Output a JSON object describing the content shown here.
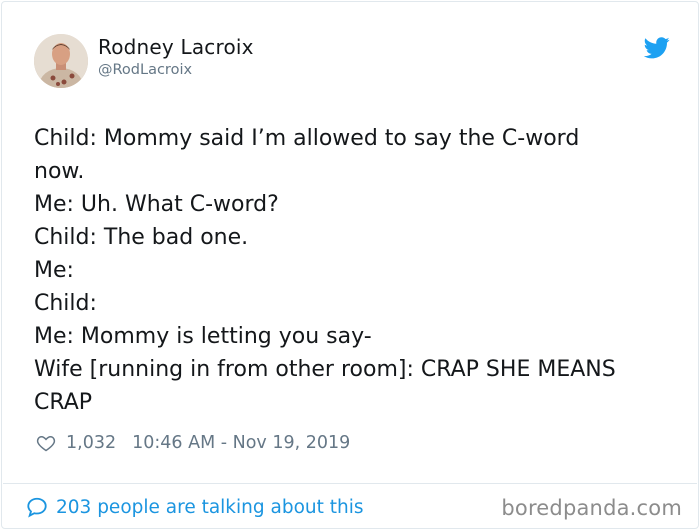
{
  "author": {
    "name": "Rodney Lacroix",
    "handle": "@RodLacroix"
  },
  "tweet": {
    "text": "Child: Mommy said I’m allowed to say the C-word\nnow.\nMe: Uh. What C-word?\nChild: The bad one.\nMe:\nChild:\nMe: Mommy is letting you say-\nWife [running in from other room]: CRAP SHE MEANS\nCRAP",
    "likes": "1,032",
    "timestamp": "10:46 AM - Nov 19, 2019"
  },
  "footer": {
    "talking": "203 people are talking about this",
    "watermark": "boredpanda.com"
  },
  "colors": {
    "twitter_blue": "#1da1f2",
    "link_blue": "#1b95e0",
    "muted": "#657786",
    "text": "#14171a",
    "border": "#e1e8ed"
  },
  "icons": {
    "twitter": "twitter-bird-icon",
    "like": "heart-outline-icon",
    "reply": "speech-bubble-icon"
  }
}
